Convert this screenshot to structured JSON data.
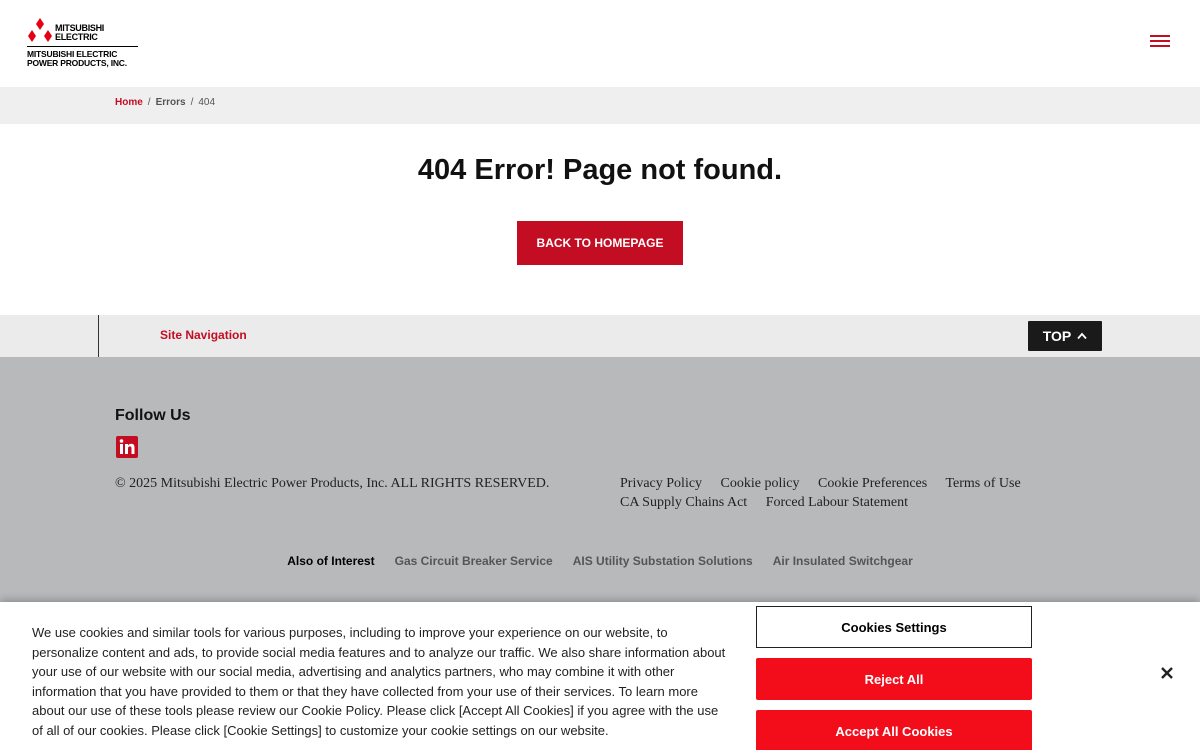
{
  "header": {
    "logo_line1": "MITSUBISHI ELECTRIC",
    "logo_line2": "MITSUBISHI ELECTRIC POWER PRODUCTS, INC.",
    "menu_icon": "hamburger-menu-icon"
  },
  "breadcrumb": {
    "home": "Home",
    "errors": "Errors",
    "current": "404",
    "separator": "/"
  },
  "main": {
    "title": "404 Error! Page not found.",
    "back_button": "BACK TO HOMEPAGE"
  },
  "sitenav": {
    "label": "Site Navigation",
    "top_button": "TOP"
  },
  "footer": {
    "follow_label": "Follow Us",
    "linkedin_icon": "linkedin-icon",
    "copyright": "© 2025 Mitsubishi Electric Power Products, Inc. ALL RIGHTS RESERVED.",
    "legal_links": [
      "Privacy Policy",
      "Cookie policy",
      "Cookie Preferences",
      "Terms of Use",
      "CA Supply Chains Act",
      "Forced Labour Statement"
    ],
    "interest_label": "Also of Interest",
    "interest_links": [
      "Gas Circuit Breaker Service",
      "AIS Utility Substation Solutions",
      "Air Insulated Switchgear"
    ]
  },
  "cookie": {
    "text": "We use cookies and similar tools for various purposes, including to improve your experience on our website, to personalize content and ads, to provide social media features and to analyze our traffic. We also share information about your use of our website with our social media, advertising and analytics partners, who may combine it with other information that you have provided to them or that they have collected from your use of their services. To learn more about our use of these tools please review our Cookie Policy. Please click [Accept All Cookies] if you agree with the use of all of our cookies. Please click [Cookie Settings] to customize your cookie settings on our website.",
    "settings_button": "Cookies Settings",
    "reject_button": "Reject All",
    "accept_button": "Accept All Cookies",
    "close_icon": "close-icon"
  },
  "colors": {
    "brand_red": "#c30d23",
    "cookie_red": "#f30d1a",
    "footer_gray": "#b8b9bb"
  }
}
